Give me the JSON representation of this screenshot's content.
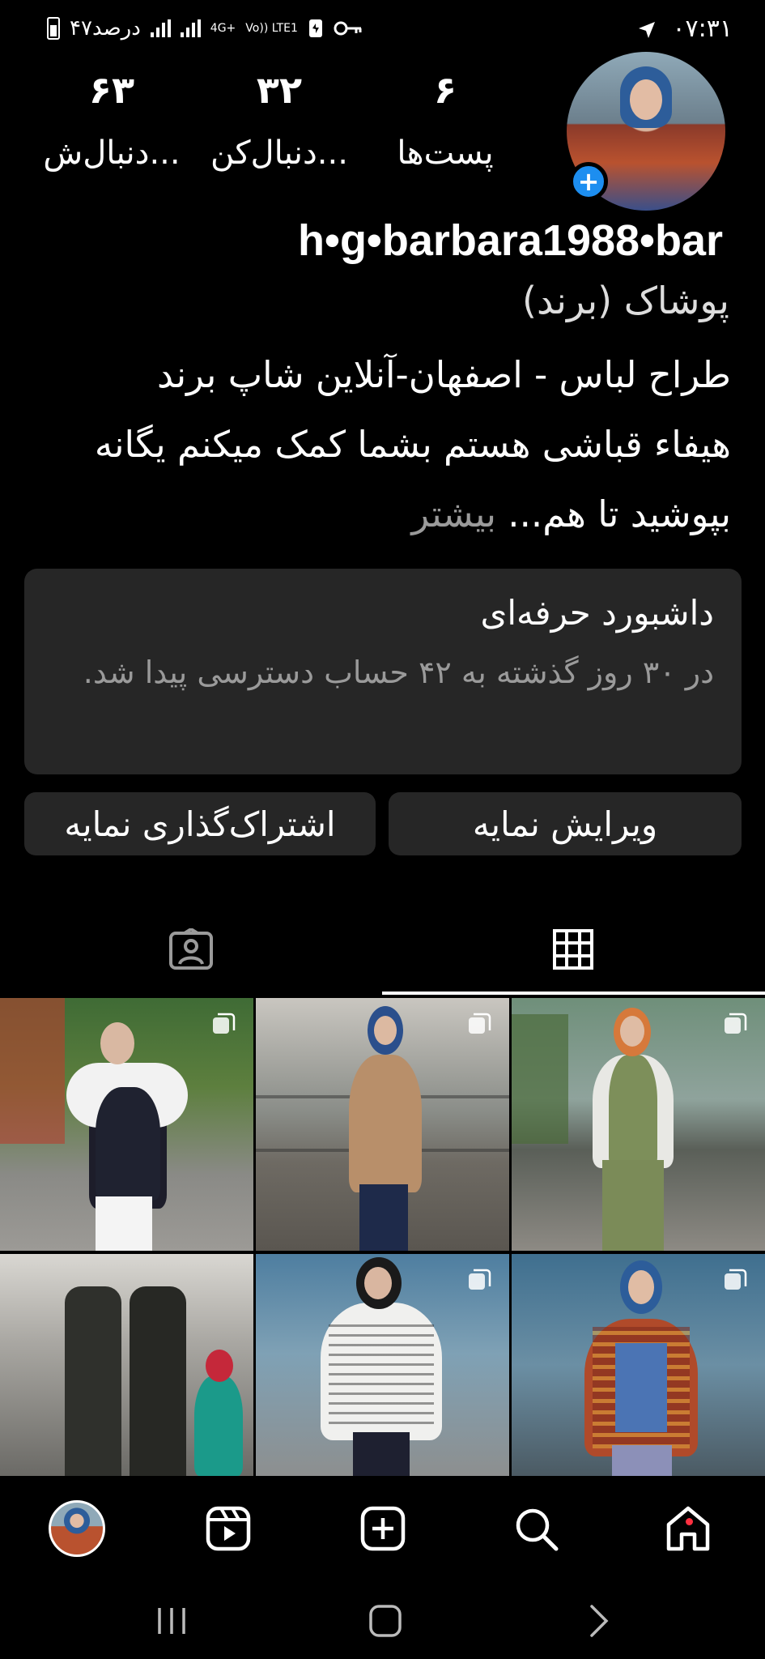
{
  "status_bar": {
    "time": "۰۷:۳۱",
    "battery_text": "۴۷درصد",
    "network_4g": "4G+",
    "network_volte": "Vo)) LTE1"
  },
  "profile": {
    "username": "h•g•barbara1988•bar",
    "category": "پوشاک (برند)",
    "bio_lines": [
      "طراح لباس - اصفهان-آنلاین شاپ برند",
      "هیفاء قباشی هستم بشما کمک میکنم یگانه",
      "بپوشید تا هم..."
    ],
    "bio_more": "بیشتر",
    "stats": [
      {
        "value": "۶",
        "label": "پست‌ها"
      },
      {
        "value": "۳۲",
        "label": "دنبال‌کن..."
      },
      {
        "value": "۶۳",
        "label": "دنبال‌ش..."
      }
    ]
  },
  "dashboard": {
    "title": "داشبورد حرفه‌ای",
    "subtitle": "در ۳۰ روز گذشته به ۴۲ حساب دسترسی پیدا شد."
  },
  "actions": {
    "edit_profile": "ویرایش نمایه",
    "share_profile": "اشتراک‌گذاری نمایه"
  },
  "tabs": [
    {
      "icon": "grid-icon",
      "active": true
    },
    {
      "icon": "tagged-icon",
      "active": false
    }
  ],
  "colors": {
    "background": "#000000",
    "card": "#262626",
    "accent": "#1d8ef0",
    "muted": "#9a9a9a",
    "notification": "#ff3040"
  },
  "bottom_nav": [
    "home-icon",
    "search-icon",
    "create-icon",
    "reels-icon",
    "profile-avatar"
  ],
  "system_nav": [
    "recents-icon",
    "home-button-icon",
    "back-icon"
  ]
}
